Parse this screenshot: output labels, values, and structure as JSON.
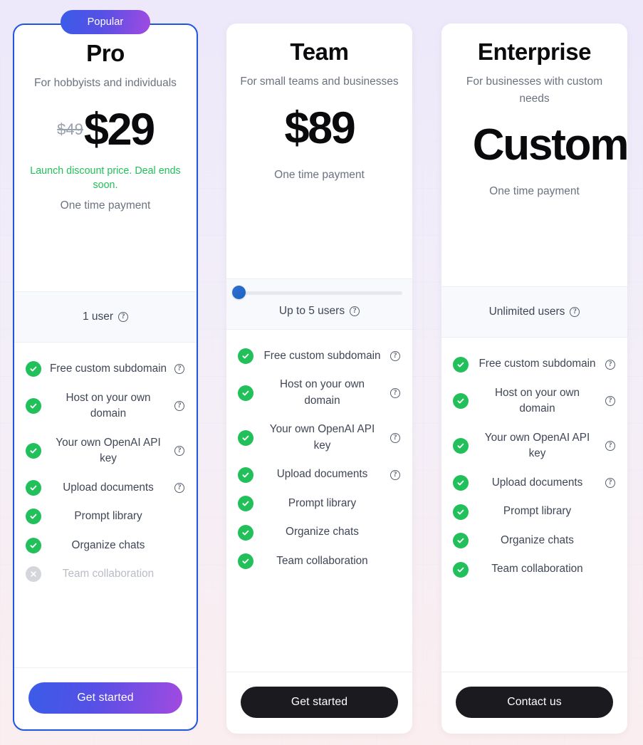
{
  "badge": {
    "popular_label": "Popular"
  },
  "icons": {
    "check": "check-circle-icon",
    "cross": "x-circle-icon",
    "help": "help-circle-icon",
    "slider_thumb": "slider-thumb-handle"
  },
  "colors": {
    "accent_blue": "#1f56e0",
    "gradient_start": "#3b5ce8",
    "gradient_end": "#a24ae0",
    "check_green": "#22c05a",
    "discount_green": "#22c05a",
    "dark_button": "#1b1b1f",
    "disabled_grey": "#d4d6dc",
    "muted_text": "#6b7280"
  },
  "help_glyph": "?",
  "plans": [
    {
      "id": "pro",
      "name": "Pro",
      "description": "For hobbyists and individuals",
      "price_old": "$49",
      "price": "$29",
      "discount_note": "Launch discount price. Deal ends soon.",
      "payment_note": "One time payment",
      "users_label": "1 user",
      "has_slider": false,
      "highlighted": true,
      "cta_label": "Get started",
      "cta_style": "gradient",
      "features": [
        {
          "label": "Free custom subdomain",
          "enabled": true,
          "has_help": true
        },
        {
          "label": "Host on your own domain",
          "enabled": true,
          "has_help": true
        },
        {
          "label": "Your own OpenAI API key",
          "enabled": true,
          "has_help": true
        },
        {
          "label": "Upload documents",
          "enabled": true,
          "has_help": true
        },
        {
          "label": "Prompt library",
          "enabled": true,
          "has_help": false
        },
        {
          "label": "Organize chats",
          "enabled": true,
          "has_help": false
        },
        {
          "label": "Team collaboration",
          "enabled": false,
          "has_help": false
        }
      ]
    },
    {
      "id": "team",
      "name": "Team",
      "description": "For small teams and businesses",
      "price_old": "",
      "price": "$89",
      "discount_note": "",
      "payment_note": "One time payment",
      "users_label": "Up to 5 users",
      "has_slider": true,
      "slider_value": 0,
      "highlighted": false,
      "cta_label": "Get started",
      "cta_style": "dark",
      "features": [
        {
          "label": "Free custom subdomain",
          "enabled": true,
          "has_help": true
        },
        {
          "label": "Host on your own domain",
          "enabled": true,
          "has_help": true
        },
        {
          "label": "Your own OpenAI API key",
          "enabled": true,
          "has_help": true
        },
        {
          "label": "Upload documents",
          "enabled": true,
          "has_help": true
        },
        {
          "label": "Prompt library",
          "enabled": true,
          "has_help": false
        },
        {
          "label": "Organize chats",
          "enabled": true,
          "has_help": false
        },
        {
          "label": "Team collaboration",
          "enabled": true,
          "has_help": false
        }
      ]
    },
    {
      "id": "enterprise",
      "name": "Enterprise",
      "description": "For businesses with custom needs",
      "price_old": "",
      "price": "Custom",
      "discount_note": "",
      "payment_note": "One time payment",
      "users_label": "Unlimited users",
      "has_slider": false,
      "highlighted": false,
      "cta_label": "Contact us",
      "cta_style": "dark",
      "features": [
        {
          "label": "Free custom subdomain",
          "enabled": true,
          "has_help": true
        },
        {
          "label": "Host on your own domain",
          "enabled": true,
          "has_help": true
        },
        {
          "label": "Your own OpenAI API key",
          "enabled": true,
          "has_help": true
        },
        {
          "label": "Upload documents",
          "enabled": true,
          "has_help": true
        },
        {
          "label": "Prompt library",
          "enabled": true,
          "has_help": false
        },
        {
          "label": "Organize chats",
          "enabled": true,
          "has_help": false
        },
        {
          "label": "Team collaboration",
          "enabled": true,
          "has_help": false
        }
      ]
    }
  ]
}
